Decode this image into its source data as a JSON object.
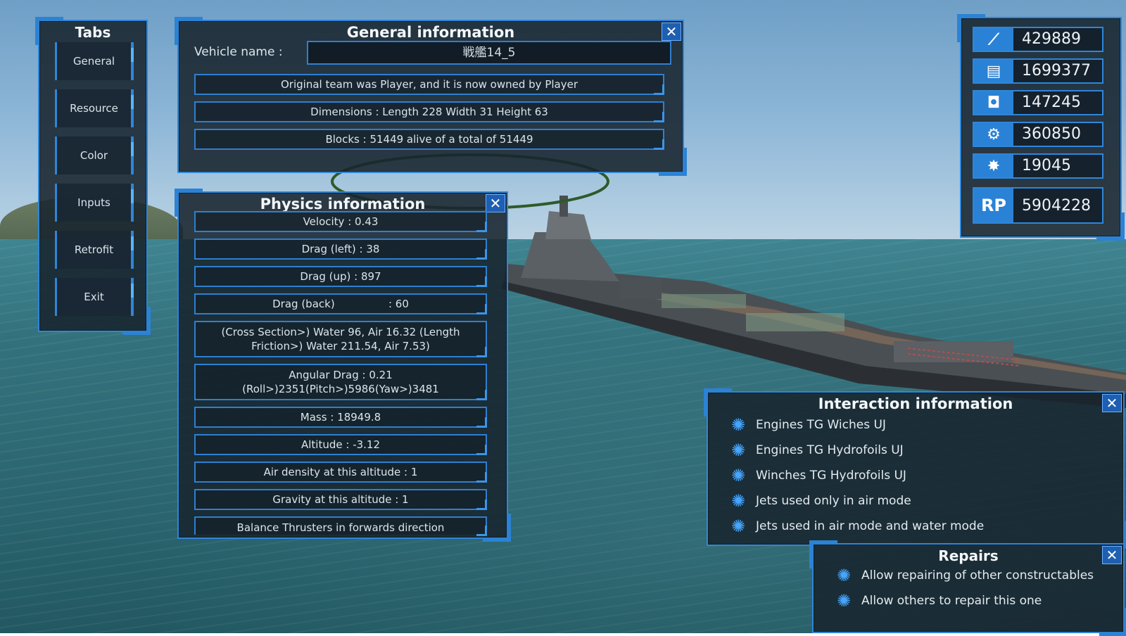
{
  "tabs": {
    "title": "Tabs",
    "items": [
      {
        "label": "General"
      },
      {
        "label": "Resource"
      },
      {
        "label": "Color"
      },
      {
        "label": "Inputs"
      },
      {
        "label": "Retrofit"
      },
      {
        "label": "Exit"
      }
    ]
  },
  "general": {
    "title": "General information",
    "close": "✕",
    "vehicle_label": "Vehicle name :",
    "vehicle_name": "戦艦14_5",
    "rows": [
      "Original team was Player, and it is now owned by Player",
      "Dimensions : Length 228 Width 31 Height 63",
      "Blocks : 51449 alive of a total of 51449"
    ]
  },
  "physics": {
    "title": "Physics information",
    "close": "✕",
    "velocity": "Velocity : 0.43",
    "drag_left": "Drag (left) : 38",
    "drag_up": "Drag (up) : 897",
    "drag_back": "Drag (back)                : 60",
    "cross_section": "(Cross Section>) Water 96, Air 16.32        (Length Friction>) Water 211.54, Air 7.53)",
    "angular_drag_1": "Angular Drag : 0.21",
    "angular_drag_2": "(Roll>)2351(Pitch>)5986(Yaw>)3481",
    "mass": "Mass : 18949.8",
    "altitude": "Altitude : -3.12",
    "air_density": "Air density at this altitude : 1",
    "gravity": "Gravity at this altitude : 1",
    "balance": "Balance Thrusters in forwards direction"
  },
  "resources": [
    {
      "icon": "plane-material-icon",
      "value": "429889"
    },
    {
      "icon": "crate-material-icon",
      "value": "1699377"
    },
    {
      "icon": "box-material-icon",
      "value": "147245"
    },
    {
      "icon": "gears-material-icon",
      "value": "360850"
    },
    {
      "icon": "explosive-material-icon",
      "value": "19045"
    },
    {
      "icon": "rp-icon",
      "icon_text": "RP",
      "value": "5904228"
    }
  ],
  "interaction": {
    "title": "Interaction information",
    "close": "✕",
    "items": [
      "Engines TG Wiches UJ",
      "Engines TG Hydrofoils UJ",
      "Winches TG Hydrofoils UJ",
      "Jets used only in air mode",
      "Jets used in air mode and water mode"
    ]
  },
  "repairs": {
    "title": "Repairs",
    "close": "✕",
    "items": [
      "Allow repairing of other constructables",
      "Allow others to repair this one"
    ]
  },
  "colors": {
    "accent": "#2f86d8",
    "panel_bg": "#18242e",
    "close_bg": "#1f5fb2"
  }
}
